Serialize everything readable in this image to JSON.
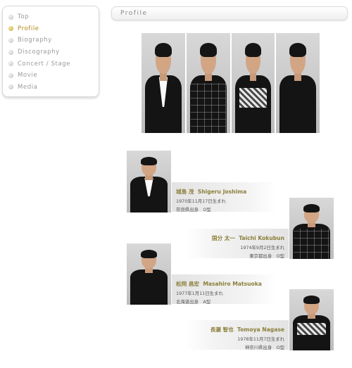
{
  "sidebar": {
    "items": [
      {
        "label": "Top",
        "active": false
      },
      {
        "label": "Profile",
        "active": true
      },
      {
        "label": "Biography",
        "active": false
      },
      {
        "label": "Discography",
        "active": false
      },
      {
        "label": "Concert / Stage",
        "active": false
      },
      {
        "label": "Movie",
        "active": false
      },
      {
        "label": "Media",
        "active": false
      }
    ]
  },
  "header": {
    "title": "Profile"
  },
  "colors": {
    "accent_gold": "#b38a1d",
    "name_gold": "#8c7f3b",
    "nav_grey": "#9a9a9a"
  },
  "members": [
    {
      "name_jp": "城島 茂",
      "name_en": "Shigeru Joshima",
      "birth": "1970年11月17日生まれ",
      "origin": "奈良県出身　O型"
    },
    {
      "name_jp": "国分 太一",
      "name_en": "Taichi Kokubun",
      "birth": "1974年9月2日生まれ",
      "origin": "東京都出身　O型"
    },
    {
      "name_jp": "松岡 昌宏",
      "name_en": "Masahiro Matsuoka",
      "birth": "1977年1月11日生まれ",
      "origin": "北海道出身　A型"
    },
    {
      "name_jp": "長瀬 智也",
      "name_en": "Tomoya Nagase",
      "birth": "1978年11月7日生まれ",
      "origin": "神奈川県出身　O型"
    }
  ]
}
